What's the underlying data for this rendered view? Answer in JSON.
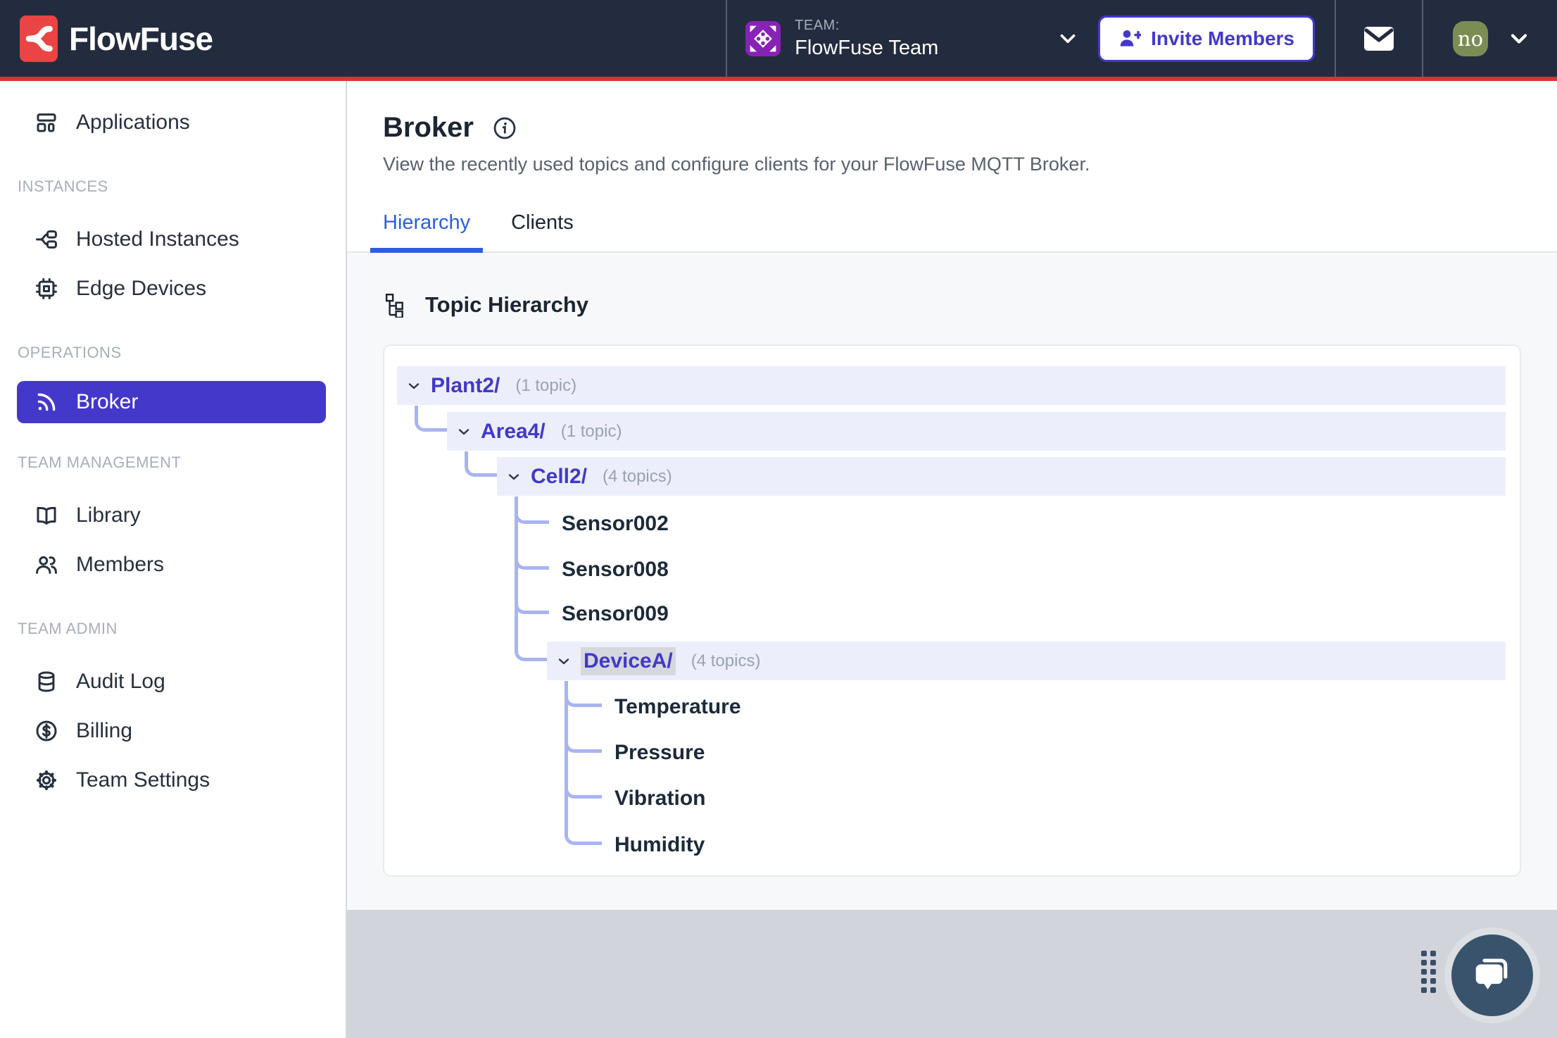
{
  "navbar": {
    "brand": "FlowFuse",
    "team_label": "TEAM:",
    "team_name": "FlowFuse Team",
    "invite_button": "Invite Members",
    "avatar_initials": "no"
  },
  "sidebar": {
    "sections": [
      "INSTANCES",
      "OPERATIONS",
      "TEAM MANAGEMENT",
      "TEAM ADMIN"
    ],
    "items": [
      {
        "label": "Applications"
      },
      {
        "label": "Hosted Instances"
      },
      {
        "label": "Edge Devices"
      },
      {
        "label": "Broker",
        "active": true
      },
      {
        "label": "Library"
      },
      {
        "label": "Members"
      },
      {
        "label": "Audit Log"
      },
      {
        "label": "Billing"
      },
      {
        "label": "Team Settings"
      }
    ]
  },
  "page": {
    "title": "Broker",
    "description": "View the recently used topics and configure clients for your FlowFuse MQTT Broker.",
    "tabs": [
      {
        "label": "Hierarchy",
        "active": true
      },
      {
        "label": "Clients",
        "active": false
      }
    ],
    "section_title": "Topic Hierarchy"
  },
  "tree": {
    "rows": [
      {
        "label": "Plant2/",
        "count": "(1 topic)",
        "type": "branch",
        "depth": 0
      },
      {
        "label": "Area4/",
        "count": "(1 topic)",
        "type": "branch",
        "depth": 1
      },
      {
        "label": "Cell2/",
        "count": "(4 topics)",
        "type": "branch",
        "depth": 2
      },
      {
        "label": "Sensor002",
        "type": "leaf",
        "depth": 3
      },
      {
        "label": "Sensor008",
        "type": "leaf",
        "depth": 3
      },
      {
        "label": "Sensor009",
        "type": "leaf",
        "depth": 3
      },
      {
        "label": "DeviceA/",
        "count": "(4 topics)",
        "type": "branch",
        "depth": 3,
        "selected": true
      },
      {
        "label": "Temperature",
        "type": "leaf",
        "depth": 4
      },
      {
        "label": "Pressure",
        "type": "leaf",
        "depth": 4
      },
      {
        "label": "Vibration",
        "type": "leaf",
        "depth": 4
      },
      {
        "label": "Humidity",
        "type": "leaf",
        "depth": 4
      }
    ]
  },
  "colors": {
    "navbar_bg": "#232C3E",
    "brand_red": "#EA4444",
    "accent_indigo": "#4338CA",
    "tab_blue": "#2D5DE2",
    "row_highlight": "#ECEFFB",
    "connector": "#A8B4F2",
    "team_avatar_purple": "#8623B5",
    "user_avatar_olive": "#7B8D53",
    "footer_gray": "#D1D5DB",
    "chat_slate": "#3A536C"
  }
}
